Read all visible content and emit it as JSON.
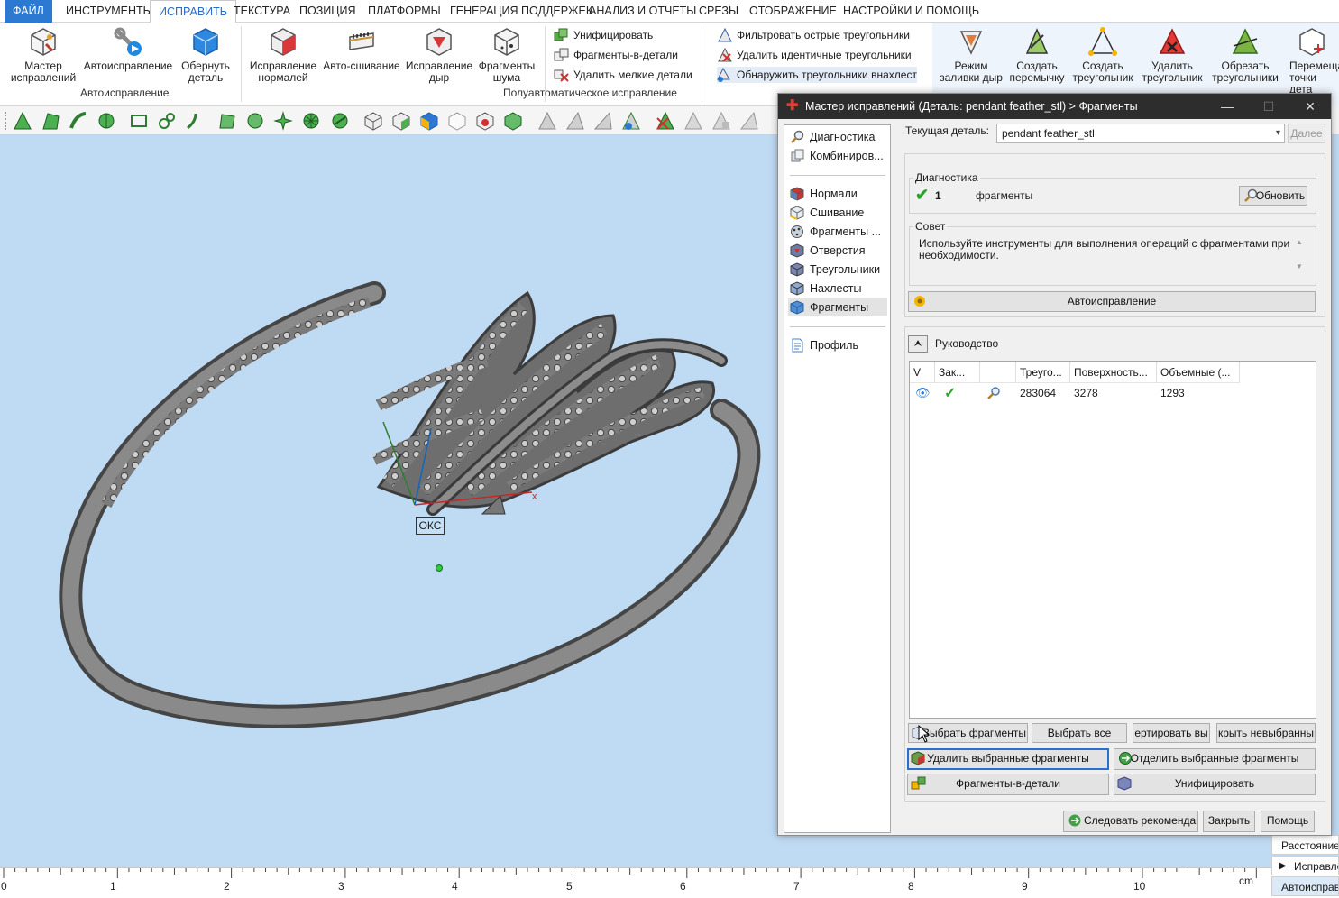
{
  "menu": {
    "items": [
      "ФАЙЛ",
      "ИНСТРУМЕНТЫ",
      "ИСПРАВИТЬ",
      "ТЕКСТУРА",
      "ПОЗИЦИЯ",
      "ПЛАТФОРМЫ",
      "ГЕНЕРАЦИЯ ПОДДЕРЖЕК",
      "АНАЛИЗ И ОТЧЕТЫ",
      "СРЕЗЫ",
      "ОТОБРАЖЕНИЕ",
      "НАСТРОЙКИ И ПОМОЩЬ"
    ],
    "active": "ИСПРАВИТЬ"
  },
  "ribbon": {
    "autofix_group": {
      "label": "Автоисправление",
      "buttons": [
        {
          "line1": "Мастер",
          "line2": "исправлений",
          "icon": "wizard-cube-icon"
        },
        {
          "line1": "Автоисправление",
          "line2": "",
          "icon": "wrench-play-icon"
        },
        {
          "line1": "Обернуть",
          "line2": "деталь",
          "icon": "wrap-cube-icon"
        }
      ]
    },
    "semiauto_group": {
      "label": "Полуавтоматическое исправление",
      "buttons": [
        {
          "line1": "Исправление",
          "line2": "нормалей",
          "icon": "normals-cube-icon"
        },
        {
          "line1": "Авто-сшивание",
          "line2": "",
          "icon": "stitch-icon"
        },
        {
          "line1": "Исправление",
          "line2": "дыр",
          "icon": "hole-fix-icon"
        },
        {
          "line1": "Фрагменты",
          "line2": "шума",
          "icon": "noise-shells-icon"
        }
      ],
      "small": [
        "Унифицировать",
        "Фрагменты-в-детали",
        "Удалить мелкие детали"
      ]
    },
    "triangle_small": [
      "Фильтровать острые треугольники",
      "Удалить идентичные треугольники",
      "Обнаружить треугольники внахлест"
    ],
    "manual_buttons": [
      {
        "line1": "Режим",
        "line2": "заливки дыр"
      },
      {
        "line1": "Создать",
        "line2": "перемычку"
      },
      {
        "line1": "Создать",
        "line2": "треугольник"
      },
      {
        "line1": "Удалить",
        "line2": "треугольник"
      },
      {
        "line1": "Обрезать",
        "line2": "треугольники"
      },
      {
        "line1": "Перемеща",
        "line2": "точки дета"
      }
    ]
  },
  "viewport": {
    "axis_x_label": "x",
    "cs_label": "ОКС"
  },
  "ruler": {
    "unit": "cm",
    "ticks": [
      "0",
      "1",
      "2",
      "3",
      "4",
      "5",
      "6",
      "7",
      "8",
      "9",
      "10"
    ]
  },
  "right_panel": {
    "items": [
      "Расстояние",
      "Исправле",
      "Автоисправ"
    ]
  },
  "dialog": {
    "title": "Мастер исправлений (Деталь: pendant feather_stl) > Фрагменты",
    "nav_top": [
      "Диагностика",
      "Комбиниров..."
    ],
    "nav_mid": [
      "Нормали",
      "Сшивание",
      "Фрагменты ...",
      "Отверстия",
      "Треугольники",
      "Нахлесты",
      "Фрагменты"
    ],
    "nav_selected": "Фрагменты",
    "nav_bottom": [
      "Профиль"
    ],
    "current_part_label": "Текущая деталь:",
    "current_part_value": "pendant feather_stl",
    "next_button": "Далее",
    "diagnostics": {
      "title": "Диагностика",
      "count": "1",
      "text": "фрагменты",
      "refresh": "Обновить"
    },
    "advice": {
      "title": "Совет",
      "text": "Используйте инструменты для выполнения операций с фрагментами при необходимости."
    },
    "autofix_button": "Автоисправление",
    "guide_title": "Руководство",
    "table": {
      "columns": [
        "V",
        "Зак...",
        "",
        "Треуго...",
        "Поверхность...",
        "Объемные (..."
      ],
      "rows": [
        [
          "",
          "",
          "",
          "283064",
          "3278",
          "1293"
        ]
      ]
    },
    "buttons": {
      "select_fragments": "Выбрать фрагменты",
      "select_all": "Выбрать все",
      "invert": "ертировать вы",
      "hide_unselected": "крыть невыбранны",
      "delete_selected": "Удалить выбранные фрагменты",
      "separate_selected": "Отделить выбранные фрагменты",
      "shells_to_parts": "Фрагменты-в-детали",
      "unify": "Унифицировать",
      "follow": "Следовать рекомендациям",
      "close": "Закрыть",
      "help": "Помощь"
    }
  },
  "colors": {
    "accent": "#2b79d0",
    "viewport_bg": "#bfdaf3",
    "title_bar": "#2d2d2d",
    "check_green": "#2aa52a"
  }
}
